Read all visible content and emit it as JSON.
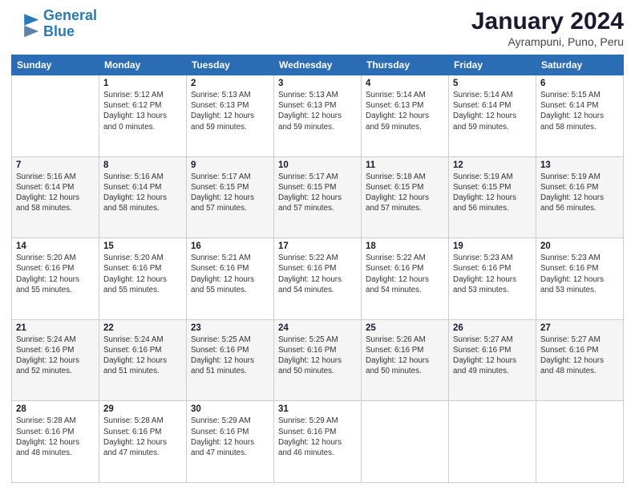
{
  "logo": {
    "line1": "General",
    "line2": "Blue"
  },
  "title": "January 2024",
  "subtitle": "Ayrampuni, Puno, Peru",
  "days_of_week": [
    "Sunday",
    "Monday",
    "Tuesday",
    "Wednesday",
    "Thursday",
    "Friday",
    "Saturday"
  ],
  "weeks": [
    [
      {
        "day": "",
        "info": ""
      },
      {
        "day": "1",
        "info": "Sunrise: 5:12 AM\nSunset: 6:12 PM\nDaylight: 13 hours\nand 0 minutes."
      },
      {
        "day": "2",
        "info": "Sunrise: 5:13 AM\nSunset: 6:13 PM\nDaylight: 12 hours\nand 59 minutes."
      },
      {
        "day": "3",
        "info": "Sunrise: 5:13 AM\nSunset: 6:13 PM\nDaylight: 12 hours\nand 59 minutes."
      },
      {
        "day": "4",
        "info": "Sunrise: 5:14 AM\nSunset: 6:13 PM\nDaylight: 12 hours\nand 59 minutes."
      },
      {
        "day": "5",
        "info": "Sunrise: 5:14 AM\nSunset: 6:14 PM\nDaylight: 12 hours\nand 59 minutes."
      },
      {
        "day": "6",
        "info": "Sunrise: 5:15 AM\nSunset: 6:14 PM\nDaylight: 12 hours\nand 58 minutes."
      }
    ],
    [
      {
        "day": "7",
        "info": "Sunrise: 5:16 AM\nSunset: 6:14 PM\nDaylight: 12 hours\nand 58 minutes."
      },
      {
        "day": "8",
        "info": "Sunrise: 5:16 AM\nSunset: 6:14 PM\nDaylight: 12 hours\nand 58 minutes."
      },
      {
        "day": "9",
        "info": "Sunrise: 5:17 AM\nSunset: 6:15 PM\nDaylight: 12 hours\nand 57 minutes."
      },
      {
        "day": "10",
        "info": "Sunrise: 5:17 AM\nSunset: 6:15 PM\nDaylight: 12 hours\nand 57 minutes."
      },
      {
        "day": "11",
        "info": "Sunrise: 5:18 AM\nSunset: 6:15 PM\nDaylight: 12 hours\nand 57 minutes."
      },
      {
        "day": "12",
        "info": "Sunrise: 5:19 AM\nSunset: 6:15 PM\nDaylight: 12 hours\nand 56 minutes."
      },
      {
        "day": "13",
        "info": "Sunrise: 5:19 AM\nSunset: 6:16 PM\nDaylight: 12 hours\nand 56 minutes."
      }
    ],
    [
      {
        "day": "14",
        "info": "Sunrise: 5:20 AM\nSunset: 6:16 PM\nDaylight: 12 hours\nand 55 minutes."
      },
      {
        "day": "15",
        "info": "Sunrise: 5:20 AM\nSunset: 6:16 PM\nDaylight: 12 hours\nand 55 minutes."
      },
      {
        "day": "16",
        "info": "Sunrise: 5:21 AM\nSunset: 6:16 PM\nDaylight: 12 hours\nand 55 minutes."
      },
      {
        "day": "17",
        "info": "Sunrise: 5:22 AM\nSunset: 6:16 PM\nDaylight: 12 hours\nand 54 minutes."
      },
      {
        "day": "18",
        "info": "Sunrise: 5:22 AM\nSunset: 6:16 PM\nDaylight: 12 hours\nand 54 minutes."
      },
      {
        "day": "19",
        "info": "Sunrise: 5:23 AM\nSunset: 6:16 PM\nDaylight: 12 hours\nand 53 minutes."
      },
      {
        "day": "20",
        "info": "Sunrise: 5:23 AM\nSunset: 6:16 PM\nDaylight: 12 hours\nand 53 minutes."
      }
    ],
    [
      {
        "day": "21",
        "info": "Sunrise: 5:24 AM\nSunset: 6:16 PM\nDaylight: 12 hours\nand 52 minutes."
      },
      {
        "day": "22",
        "info": "Sunrise: 5:24 AM\nSunset: 6:16 PM\nDaylight: 12 hours\nand 51 minutes."
      },
      {
        "day": "23",
        "info": "Sunrise: 5:25 AM\nSunset: 6:16 PM\nDaylight: 12 hours\nand 51 minutes."
      },
      {
        "day": "24",
        "info": "Sunrise: 5:25 AM\nSunset: 6:16 PM\nDaylight: 12 hours\nand 50 minutes."
      },
      {
        "day": "25",
        "info": "Sunrise: 5:26 AM\nSunset: 6:16 PM\nDaylight: 12 hours\nand 50 minutes."
      },
      {
        "day": "26",
        "info": "Sunrise: 5:27 AM\nSunset: 6:16 PM\nDaylight: 12 hours\nand 49 minutes."
      },
      {
        "day": "27",
        "info": "Sunrise: 5:27 AM\nSunset: 6:16 PM\nDaylight: 12 hours\nand 48 minutes."
      }
    ],
    [
      {
        "day": "28",
        "info": "Sunrise: 5:28 AM\nSunset: 6:16 PM\nDaylight: 12 hours\nand 48 minutes."
      },
      {
        "day": "29",
        "info": "Sunrise: 5:28 AM\nSunset: 6:16 PM\nDaylight: 12 hours\nand 47 minutes."
      },
      {
        "day": "30",
        "info": "Sunrise: 5:29 AM\nSunset: 6:16 PM\nDaylight: 12 hours\nand 47 minutes."
      },
      {
        "day": "31",
        "info": "Sunrise: 5:29 AM\nSunset: 6:16 PM\nDaylight: 12 hours\nand 46 minutes."
      },
      {
        "day": "",
        "info": ""
      },
      {
        "day": "",
        "info": ""
      },
      {
        "day": "",
        "info": ""
      }
    ]
  ]
}
